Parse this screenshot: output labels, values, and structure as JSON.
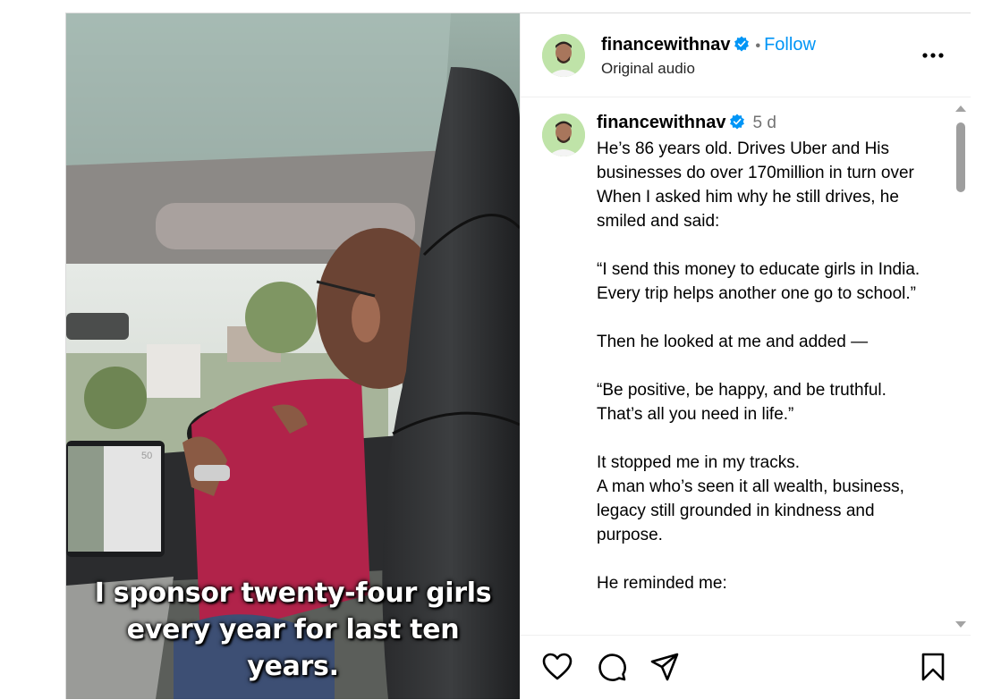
{
  "header": {
    "username": "financewithnav",
    "separator": "•",
    "follow_label": "Follow",
    "audio_label": "Original audio"
  },
  "video": {
    "caption_lines": [
      "I sponsor twenty-four girls",
      "every year for last ten",
      "years."
    ],
    "screen_speed": "50"
  },
  "comment": {
    "username": "financewithnav",
    "time": "5 d",
    "text": "He’s 86 years old. Drives Uber and His businesses do over 170million in turn over\nWhen I asked him why he still drives, he smiled and said:\n\n“I send this money to educate girls in India. Every trip helps another one go to school.”\n\nThen he looked at me and added —\n\n“Be positive, be happy, and be truthful. That’s all you need in life.”\n\nIt stopped me in my tracks.\nA man who’s seen it all wealth, business, legacy still grounded in kindness and purpose.\n\nHe reminded me:"
  },
  "icons": {
    "verified": "verified-badge-icon",
    "more": "more-options-icon",
    "like": "heart-icon",
    "comment": "comment-icon",
    "share": "share-icon",
    "save": "bookmark-icon"
  },
  "colors": {
    "accent": "#0095f6",
    "verified": "#0095f6",
    "muted": "#737373"
  }
}
